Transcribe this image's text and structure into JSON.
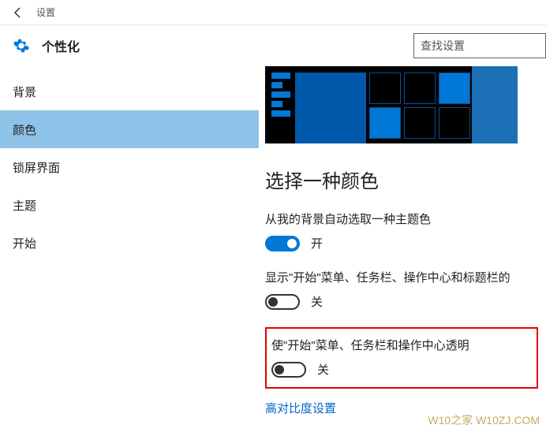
{
  "titlebar": {
    "title": "设置"
  },
  "header": {
    "caption": "个性化"
  },
  "search": {
    "placeholder": "查找设置"
  },
  "sidebar": {
    "selected_index": 1,
    "items": [
      {
        "label": "背景"
      },
      {
        "label": "颜色"
      },
      {
        "label": "锁屏界面"
      },
      {
        "label": "主题"
      },
      {
        "label": "开始"
      }
    ]
  },
  "content": {
    "heading": "选择一种颜色",
    "settings": [
      {
        "label": "从我的背景自动选取一种主题色",
        "on": true,
        "state_text": "开"
      },
      {
        "label": "显示\"开始\"菜单、任务栏、操作中心和标题栏的",
        "on": false,
        "state_text": "关"
      },
      {
        "label": "使\"开始\"菜单、任务栏和操作中心透明",
        "on": false,
        "state_text": "关",
        "highlighted": true
      }
    ],
    "link": "高对比度设置"
  },
  "watermark": "W10之家 W10ZJ.COM",
  "colors": {
    "accent": "#0078d7",
    "highlight": "#e60000",
    "sidebar_selected": "#8fc2e8"
  }
}
